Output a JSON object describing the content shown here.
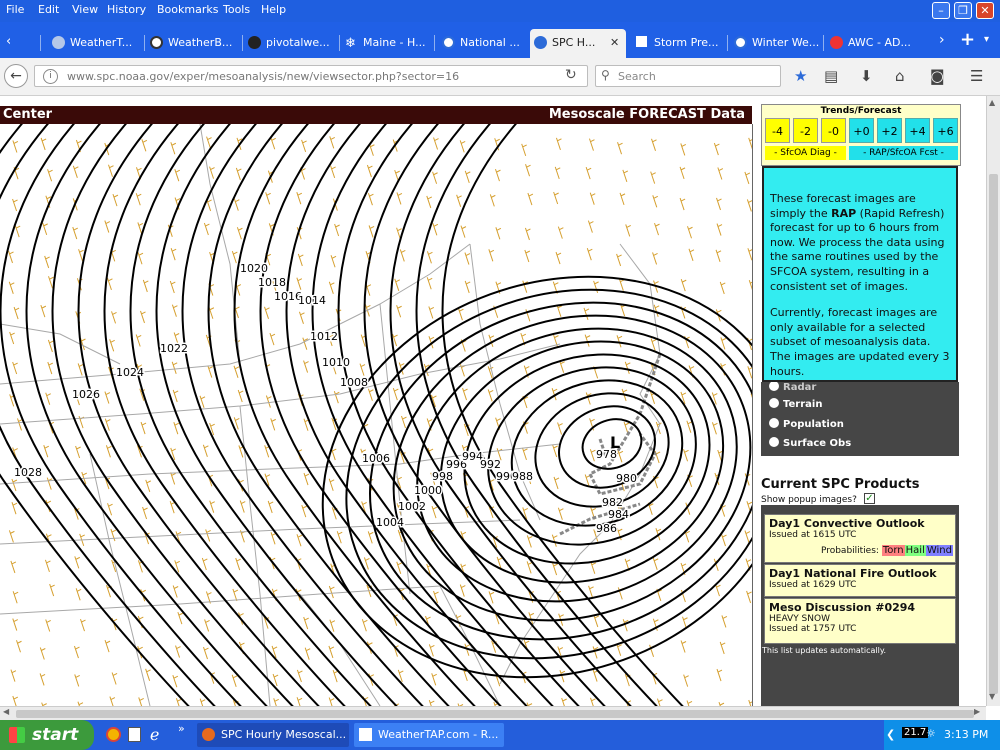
{
  "menu": [
    "File",
    "Edit",
    "View",
    "History",
    "Bookmarks",
    "Tools",
    "Help"
  ],
  "tabs": [
    {
      "label": "WeatherT...",
      "icon": "globe-icon"
    },
    {
      "label": "WeatherB...",
      "icon": "weatherbell-icon"
    },
    {
      "label": "pivotalwe...",
      "icon": "gear-icon"
    },
    {
      "label": "Maine - H...",
      "icon": "snowflake-icon"
    },
    {
      "label": "National ...",
      "icon": "nws-icon"
    },
    {
      "label": "SPC H...",
      "icon": "noaa-icon",
      "active": true
    },
    {
      "label": "Storm Pre...",
      "icon": "storm-icon"
    },
    {
      "label": "Winter We...",
      "icon": "nws-icon"
    },
    {
      "label": "AWC - AD...",
      "icon": "awc-icon"
    }
  ],
  "url": "www.spc.noaa.gov/exper/mesoanalysis/new/viewsector.php?sector=16",
  "search_placeholder": "Search",
  "map": {
    "header_left": "Center",
    "header_right": "Mesoscale FORECAST Data",
    "isobar_labels": [
      "1020",
      "1018",
      "1016",
      "1014",
      "1012",
      "1010",
      "1008",
      "1022",
      "1024",
      "1026",
      "1028",
      "1006",
      "1004",
      "1002",
      "1000",
      "998",
      "996",
      "994",
      "992",
      "990",
      "988",
      "978",
      "980",
      "982",
      "984",
      "986"
    ],
    "low_center_symbol": "L"
  },
  "trends": {
    "title": "Trends/Forecast",
    "diag_buttons": [
      "-4",
      "-2",
      "-0"
    ],
    "fcst_buttons": [
      "+0",
      "+2",
      "+4",
      "+6"
    ],
    "diag_label": "- SfcOA Diag -",
    "fcst_label": "- RAP/SfcOA Fcst -"
  },
  "popup": {
    "p1_before": "These forecast images are simply the ",
    "p1_bold": "RAP",
    "p1_after": " (Rapid Refresh) forecast for up to 6 hours from now. We process the data using the same routines used by the SFCOA system, resulting in a consistent set of images.",
    "p2": "Currently, forecast images are only available for a selected subset of mesoanalysis data. The images are updated every 3 hours."
  },
  "overlay_options": [
    "Radar",
    "Terrain",
    "Population",
    "Surface Obs"
  ],
  "spc_products": {
    "title": "Current SPC Products",
    "popup_label": "Show popup images?",
    "cards": [
      {
        "title": "Day1 Convective Outlook",
        "issued": "Issued at 1615 UTC",
        "prob_label": "Probabilities:",
        "probs": [
          "Torn",
          "Hail",
          "Wind"
        ]
      },
      {
        "title": "Day1 National Fire Outlook",
        "issued": "Issued at 1629 UTC"
      },
      {
        "title": "Meso Discussion #0294",
        "sub": "HEAVY SNOW",
        "issued": "Issued at 1757 UTC"
      }
    ],
    "footer": "This list updates automatically."
  },
  "taskbar": {
    "start": "start",
    "tasks": [
      "SPC Hourly Mesoscal...",
      "WeatherTAP.com - R..."
    ],
    "tray_temp": "21.7",
    "clock": "3:13 PM"
  },
  "colors": {
    "menubar": "#1f5fe0",
    "map_header": "#3a0a08",
    "diag_button": "#ffff00",
    "fcst_button": "#22e0ea",
    "popup_bg": "#33ecf0",
    "card_bg": "#ffffc8",
    "torn": "#ff8080",
    "hail": "#80ff80",
    "wind": "#8080ff",
    "isobar": "#000000",
    "wind_barb": "#d6a030"
  }
}
